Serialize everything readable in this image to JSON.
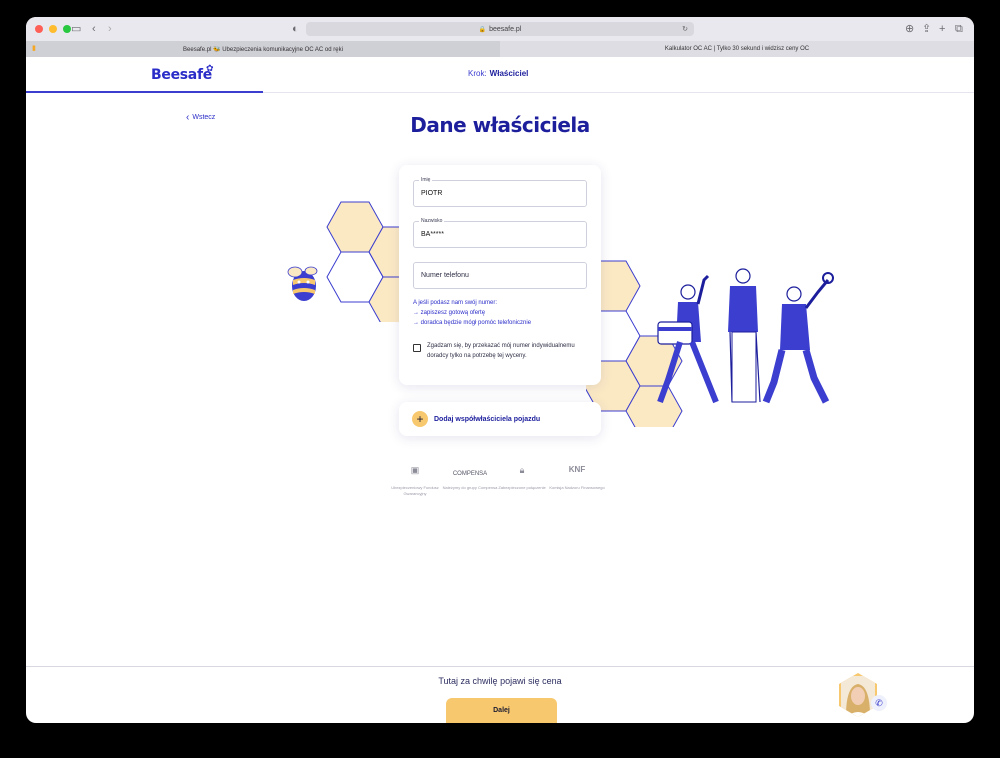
{
  "browser": {
    "url": "beesafe.pl",
    "tabs": [
      {
        "title": "Beesafe.pl 🐝 Ubezpieczenia komunikacyjne OC AC od ręki",
        "active": true
      },
      {
        "title": "Kalkulator OC AC | Tylko 30 sekund i widzisz ceny OC",
        "active": false
      }
    ]
  },
  "header": {
    "logo": "Beesafe",
    "step_prefix": "Krok:",
    "step_name": "Właściciel"
  },
  "page": {
    "back_label": "Wstecz",
    "title": "Dane właściciela"
  },
  "form": {
    "first_name": {
      "label": "Imię",
      "value": "PIOTR"
    },
    "last_name": {
      "label": "Nazwisko",
      "value": "BA*****"
    },
    "phone": {
      "placeholder": "Numer telefonu"
    },
    "hint": {
      "lead": "A jeśli podasz nam swój numer:",
      "line1": "→ zapiszesz gotową ofertę",
      "line2": "→ doradca będzie mógł pomóc telefonicznie"
    },
    "consent": "Zgadzam się, by przekazać mój numer indywidualnemu doradcy tylko na potrzebę tej wyceny.",
    "consent_checked": false
  },
  "coowner": {
    "icon": "+",
    "label": "Dodaj współwłaściciela pojazdu"
  },
  "trust": [
    {
      "icon": "guarantee-fund-icon",
      "logo": "",
      "text": "Ubezpieczeniowy Fundusz Gwarancyjny"
    },
    {
      "icon": "compensa-logo",
      "logo": "COMPENSA",
      "text": "Należymy do grupy Compensa"
    },
    {
      "icon": "padlock-icon",
      "logo": "",
      "text": "Zabezpieczone połączenie"
    },
    {
      "icon": "knf-logo",
      "logo": "KNF",
      "text": "Komisja Nadzoru Finansowego"
    }
  ],
  "footer": {
    "price_text": "Tutaj za chwilę pojawi się cena",
    "next_label": "Dalej"
  },
  "colors": {
    "brand_blue": "#2b2dc8",
    "dark_blue": "#1c1e9c",
    "honey": "#f7c86e",
    "hex_fill": "#fbe9c4"
  }
}
